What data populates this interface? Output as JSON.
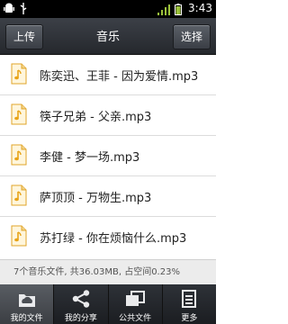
{
  "status_bar": {
    "time": "3:43"
  },
  "header": {
    "upload_label": "上传",
    "title": "音乐",
    "select_label": "选择"
  },
  "files": [
    {
      "name": "陈奕迅、王菲 - 因为爱情.mp3"
    },
    {
      "name": "筷子兄弟 - 父亲.mp3"
    },
    {
      "name": "李健 - 梦一场.mp3"
    },
    {
      "name": "萨顶顶 - 万物生.mp3"
    },
    {
      "name": "苏打绿 - 你在烦恼什么.mp3"
    }
  ],
  "summary": "7个音乐文件, 共36.03MB, 占空间0.23%",
  "bottom_nav": [
    {
      "label": "我的文件",
      "icon": "cloud-folder-icon"
    },
    {
      "label": "我的分享",
      "icon": "share-icon"
    },
    {
      "label": "公共文件",
      "icon": "public-files-icon"
    },
    {
      "label": "更多",
      "icon": "more-icon"
    }
  ],
  "colors": {
    "header_bg": "#30343a",
    "file_icon": "#f2b632",
    "active_tab": "#4a4e54"
  }
}
